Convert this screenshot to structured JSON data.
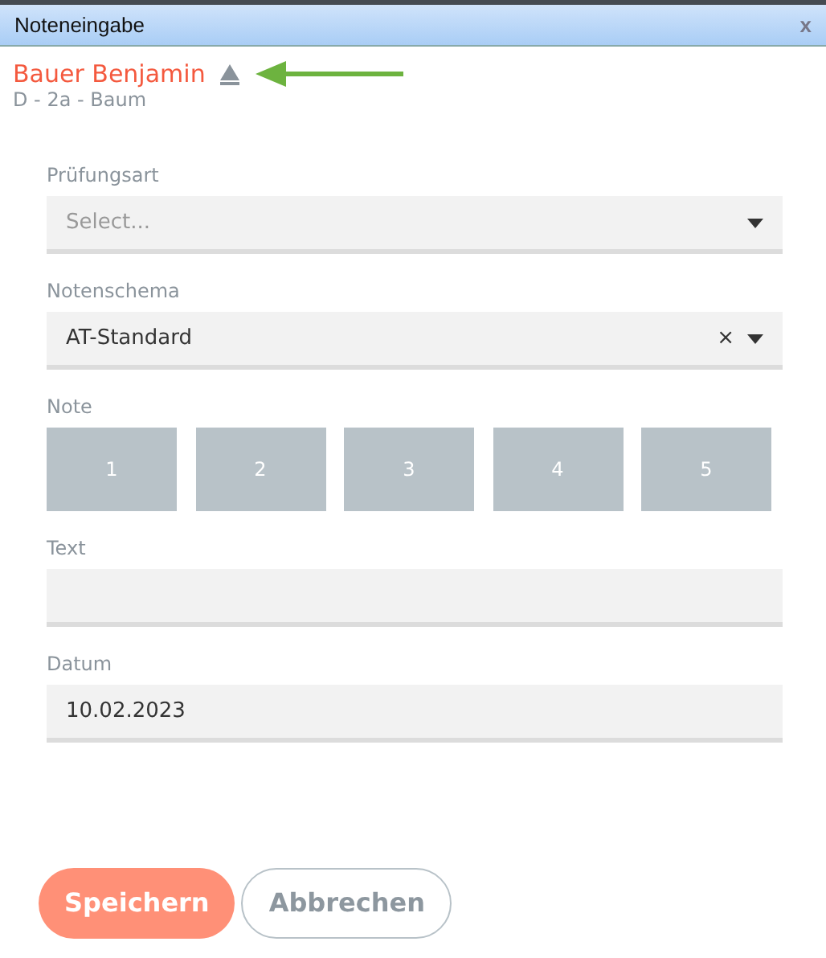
{
  "window": {
    "title": "Noteneingabe",
    "close": "x"
  },
  "student": {
    "name": "Bauer Benjamin",
    "details": "D - 2a - Baum"
  },
  "fields": [
    {
      "kind": "select",
      "label": "Prüfungsart",
      "placeholder": "Select..."
    },
    {
      "kind": "select",
      "label": "Notenschema",
      "value": "AT-Standard",
      "clear": "×"
    },
    {
      "kind": "grades",
      "label": "Note",
      "options": [
        {
          "label": "1",
          "selected": false
        },
        {
          "label": "2",
          "selected": false
        },
        {
          "label": "3",
          "selected": false
        },
        {
          "label": "4",
          "selected": false
        },
        {
          "label": "5",
          "selected": false
        }
      ]
    },
    {
      "kind": "text",
      "label": "Text"
    },
    {
      "kind": "text",
      "label": "Datum",
      "value": "10.02.2023"
    }
  ],
  "buttons": [
    {
      "label": "Speichern",
      "kind": "primary"
    },
    {
      "label": "Abbrechen",
      "kind": "secondary"
    }
  ]
}
